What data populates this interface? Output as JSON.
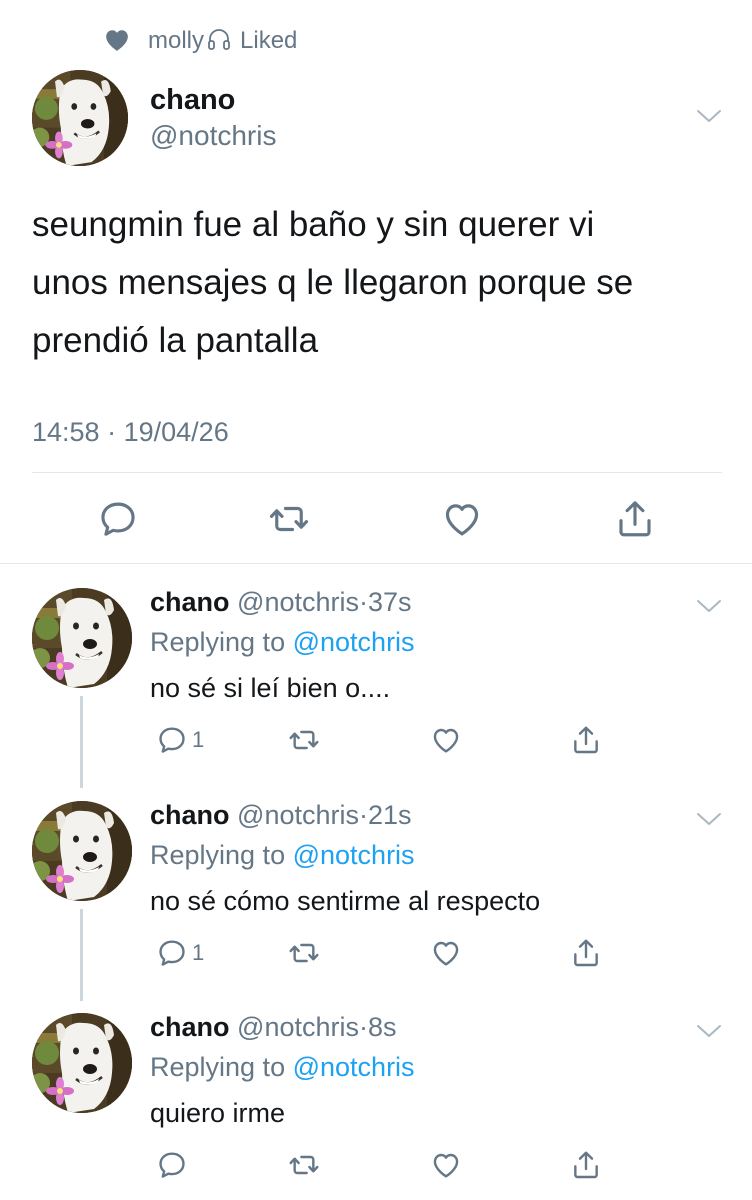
{
  "liked_by": {
    "name": "molly",
    "name_icon": "headphones-icon",
    "label": "Liked"
  },
  "main_tweet": {
    "author_name": "chano",
    "author_handle": "@notchris",
    "text_lines": [
      "seungmin fue al baño y sin querer vi",
      "unos mensajes q le llegaron porque se",
      "prendió la pantalla"
    ],
    "time": "14:58",
    "date_separator": "·",
    "date": "19/04/26"
  },
  "replies": [
    {
      "author_name": "chano",
      "author_handle": "@notchris",
      "separator": "·",
      "time_ago": "37s",
      "replying_prefix": "Replying to",
      "replying_handle": "@notchris",
      "text": "no sé si leí bien o....",
      "reply_count": "1"
    },
    {
      "author_name": "chano",
      "author_handle": "@notchris",
      "separator": "·",
      "time_ago": "21s",
      "replying_prefix": "Replying to",
      "replying_handle": "@notchris",
      "text": "no sé cómo sentirme al respecto",
      "reply_count": "1"
    },
    {
      "author_name": "chano",
      "author_handle": "@notchris",
      "separator": "·",
      "time_ago": "8s",
      "replying_prefix": "Replying to",
      "replying_handle": "@notchris",
      "text": "quiero irme",
      "reply_count": ""
    }
  ],
  "colors": {
    "text": "#14171a",
    "secondary": "#657786",
    "link": "#1da1f2",
    "divider": "#e1e8ed",
    "thread_line": "#ccd6dd"
  }
}
